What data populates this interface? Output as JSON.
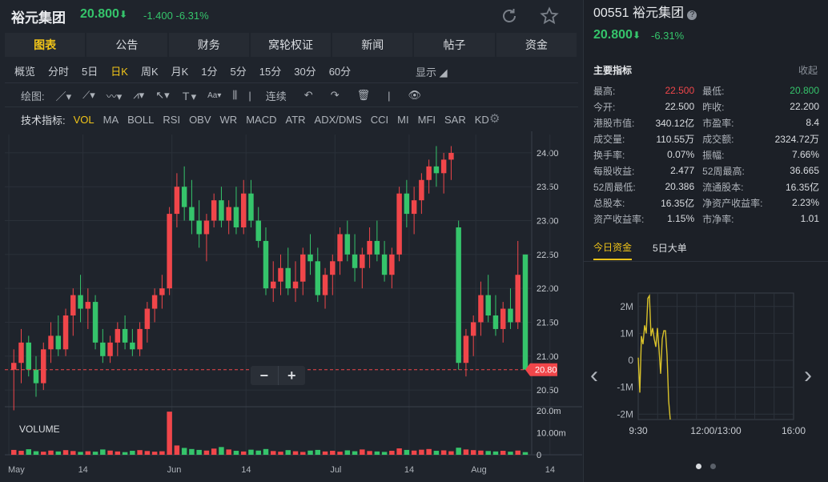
{
  "header": {
    "name": "裕元集团",
    "price": "20.800",
    "arrow": "⬇",
    "change": "-1.400",
    "change_pct": "-6.31%",
    "icons": [
      "refresh-icon",
      "star-icon"
    ]
  },
  "tabs": [
    "图表",
    "公告",
    "财务",
    "窝轮权证",
    "新闻",
    "帖子",
    "资金"
  ],
  "active_tab": "图表",
  "periods": [
    "概览",
    "分时",
    "5日",
    "日K",
    "周K",
    "月K",
    "1分",
    "5分",
    "15分",
    "30分",
    "60分"
  ],
  "active_period": "日K",
  "display_label": "显示",
  "draw_toolbar": {
    "label": "绘图:",
    "continuous": "连续"
  },
  "indicators": {
    "label": "技术指标:",
    "items": [
      "VOL",
      "MA",
      "BOLL",
      "RSI",
      "OBV",
      "WR",
      "MACD",
      "ATR",
      "ADX/DMS",
      "CCI",
      "MI",
      "MFI",
      "SAR",
      "KD"
    ],
    "active": "VOL"
  },
  "zoom": {
    "minus": "−",
    "plus": "+"
  },
  "chart_data": [
    {
      "type": "candlestick",
      "ylim": [
        20.3,
        24.2
      ],
      "yticks": [
        "24.00",
        "23.50",
        "23.00",
        "22.50",
        "22.00",
        "21.50",
        "21.00",
        "20.50"
      ],
      "last_price_label": "20.80",
      "x_labels": [
        "May",
        "14",
        "Jun",
        "14",
        "Jul",
        "14",
        "Aug",
        "14"
      ],
      "candles": [
        [
          20.8,
          21.1,
          20.2,
          20.9
        ],
        [
          20.9,
          21.4,
          20.6,
          21.2
        ],
        [
          21.2,
          21.3,
          20.7,
          20.8
        ],
        [
          20.8,
          21.0,
          20.4,
          20.6
        ],
        [
          20.6,
          21.2,
          20.5,
          21.1
        ],
        [
          21.1,
          21.5,
          20.9,
          21.3
        ],
        [
          21.3,
          21.6,
          21.0,
          21.1
        ],
        [
          21.1,
          21.7,
          21.0,
          21.6
        ],
        [
          21.6,
          22.0,
          21.3,
          21.9
        ],
        [
          21.9,
          22.2,
          21.5,
          21.7
        ],
        [
          21.7,
          22.0,
          21.4,
          21.8
        ],
        [
          21.8,
          21.9,
          21.1,
          21.2
        ],
        [
          21.2,
          21.4,
          20.9,
          21.0
        ],
        [
          21.0,
          21.3,
          20.9,
          21.2
        ],
        [
          21.2,
          21.5,
          21.0,
          21.4
        ],
        [
          21.4,
          21.6,
          21.1,
          21.2
        ],
        [
          21.2,
          21.4,
          21.0,
          21.1
        ],
        [
          21.1,
          21.5,
          21.0,
          21.4
        ],
        [
          21.4,
          21.8,
          21.2,
          21.7
        ],
        [
          21.7,
          22.0,
          21.5,
          21.9
        ],
        [
          21.9,
          22.2,
          21.7,
          22.0
        ],
        [
          22.0,
          23.2,
          21.9,
          23.1
        ],
        [
          23.1,
          23.7,
          22.9,
          23.5
        ],
        [
          23.5,
          23.8,
          23.0,
          23.2
        ],
        [
          23.2,
          23.6,
          22.8,
          23.0
        ],
        [
          23.0,
          23.3,
          22.6,
          22.8
        ],
        [
          22.8,
          23.1,
          22.4,
          23.0
        ],
        [
          23.0,
          23.4,
          22.9,
          23.3
        ],
        [
          23.3,
          23.5,
          22.9,
          23.0
        ],
        [
          23.0,
          23.3,
          22.8,
          23.2
        ],
        [
          23.2,
          23.5,
          22.8,
          22.9
        ],
        [
          22.9,
          23.6,
          22.8,
          23.4
        ],
        [
          23.4,
          23.6,
          22.9,
          23.0
        ],
        [
          23.0,
          23.2,
          22.6,
          22.7
        ],
        [
          22.7,
          22.9,
          21.9,
          22.0
        ],
        [
          22.0,
          22.4,
          21.8,
          22.1
        ],
        [
          22.1,
          22.5,
          21.9,
          22.3
        ],
        [
          22.3,
          22.6,
          21.9,
          22.0
        ],
        [
          22.0,
          22.4,
          21.8,
          22.1
        ],
        [
          22.1,
          22.6,
          21.9,
          22.5
        ],
        [
          22.5,
          22.8,
          22.2,
          22.4
        ],
        [
          22.4,
          22.6,
          21.8,
          21.9
        ],
        [
          21.9,
          22.3,
          21.7,
          22.2
        ],
        [
          22.2,
          22.5,
          21.9,
          22.4
        ],
        [
          22.4,
          22.9,
          22.2,
          22.8
        ],
        [
          22.8,
          23.0,
          22.4,
          22.5
        ],
        [
          22.5,
          22.8,
          22.1,
          22.3
        ],
        [
          22.3,
          22.6,
          22.0,
          22.5
        ],
        [
          22.5,
          22.9,
          22.3,
          22.7
        ],
        [
          22.7,
          23.0,
          22.4,
          22.5
        ],
        [
          22.5,
          22.7,
          22.1,
          22.2
        ],
        [
          22.2,
          22.6,
          22.0,
          22.5
        ],
        [
          22.5,
          23.5,
          22.4,
          23.4
        ],
        [
          23.4,
          23.6,
          22.9,
          23.1
        ],
        [
          23.1,
          23.5,
          22.8,
          23.3
        ],
        [
          23.3,
          23.7,
          23.1,
          23.6
        ],
        [
          23.6,
          23.9,
          23.4,
          23.8
        ],
        [
          23.8,
          24.1,
          23.5,
          23.7
        ],
        [
          23.7,
          24.0,
          23.4,
          23.9
        ],
        [
          23.9,
          24.1,
          23.6,
          24.0
        ],
        [
          22.9,
          23.0,
          20.8,
          20.9
        ],
        [
          20.9,
          21.4,
          20.7,
          21.3
        ],
        [
          21.3,
          21.6,
          21.0,
          21.5
        ],
        [
          21.5,
          22.1,
          21.3,
          21.9
        ],
        [
          21.9,
          22.2,
          21.5,
          21.6
        ],
        [
          21.6,
          21.9,
          21.3,
          21.4
        ],
        [
          21.4,
          21.8,
          21.2,
          21.7
        ],
        [
          21.7,
          22.0,
          21.4,
          21.5
        ],
        [
          21.5,
          22.7,
          21.4,
          22.2
        ],
        [
          22.5,
          22.5,
          20.8,
          20.8
        ]
      ],
      "volume": {
        "label": "VOLUME",
        "yticks": [
          "20.0m",
          "10.00m",
          "0"
        ],
        "values": [
          2.2,
          1.8,
          2.5,
          1.6,
          1.4,
          1.9,
          1.5,
          2.1,
          1.7,
          1.3,
          1.6,
          1.4,
          2.4,
          1.9,
          1.5,
          1.2,
          1.8,
          2.1,
          1.7,
          1.4,
          1.6,
          19.5,
          4.2,
          3.1,
          2.6,
          2.2,
          1.9,
          2.8,
          3.5,
          2.4,
          1.8,
          1.5,
          2.3,
          1.9,
          2.6,
          1.7,
          1.4,
          2.1,
          1.6,
          1.3,
          1.9,
          2.2,
          1.5,
          1.8,
          1.4,
          2.0,
          1.6,
          2.4,
          1.7,
          1.5,
          1.3,
          1.8,
          2.9,
          2.2,
          1.9,
          2.3,
          2.6,
          1.8,
          2.0,
          1.6,
          3.2,
          2.4,
          2.1,
          1.9,
          1.7,
          1.5,
          1.8,
          1.4,
          1.9,
          1.2
        ]
      }
    },
    {
      "type": "line",
      "yticks": [
        "2M",
        "1M",
        "0",
        "-1M",
        "-2M"
      ],
      "ylim": [
        -2.2,
        2.5
      ],
      "x_labels": [
        "9:30",
        "12:00/13:00",
        "16:00"
      ],
      "x": [
        0,
        0.5,
        1,
        1.5,
        2,
        2.5,
        3,
        3.5,
        4,
        4.5,
        5,
        5.5,
        6,
        6.5,
        7,
        7.5,
        8,
        8.5,
        9,
        9.5,
        10
      ],
      "values": [
        0.1,
        -1.2,
        0.9,
        0.6,
        1.3,
        1.0,
        2.3,
        2.4,
        0.9,
        1.2,
        0.8,
        0.5,
        1.2,
        0.4,
        -0.5,
        0.8,
        1.1,
        1.1,
        0.2,
        -1.5,
        -2.2
      ]
    }
  ],
  "right": {
    "title": "00551 裕元集团",
    "price": "20.800",
    "arrow": "⬇",
    "pct": "-6.31%",
    "section_title": "主要指标",
    "collapse": "收起",
    "metrics": [
      [
        "最高:",
        "22.500",
        "最低:",
        "20.800"
      ],
      [
        "今开:",
        "22.500",
        "昨收:",
        "22.200"
      ],
      [
        "港股市值:",
        "340.12亿",
        "市盈率:",
        "8.4"
      ],
      [
        "成交量:",
        "110.55万",
        "成交额:",
        "2324.72万"
      ],
      [
        "换手率:",
        "0.07%",
        "振幅:",
        "7.66%"
      ],
      [
        "每股收益:",
        "2.477",
        "52周最高:",
        "36.665"
      ],
      [
        "52周最低:",
        "20.386",
        "流通股本:",
        "16.35亿"
      ],
      [
        "总股本:",
        "16.35亿",
        "净资产收益率:",
        "2.23%"
      ],
      [
        "资产收益率:",
        "1.15%",
        "市净率:",
        "1.01"
      ]
    ],
    "fund_tabs": [
      "今日资金",
      "5日大单"
    ],
    "active_fund_tab": "今日资金",
    "nav": {
      "prev": "‹",
      "next": "›"
    }
  },
  "colors": {
    "up": "#f0464a",
    "down": "#35c46b",
    "accent": "#f0c419",
    "line": "#d9c22a"
  }
}
